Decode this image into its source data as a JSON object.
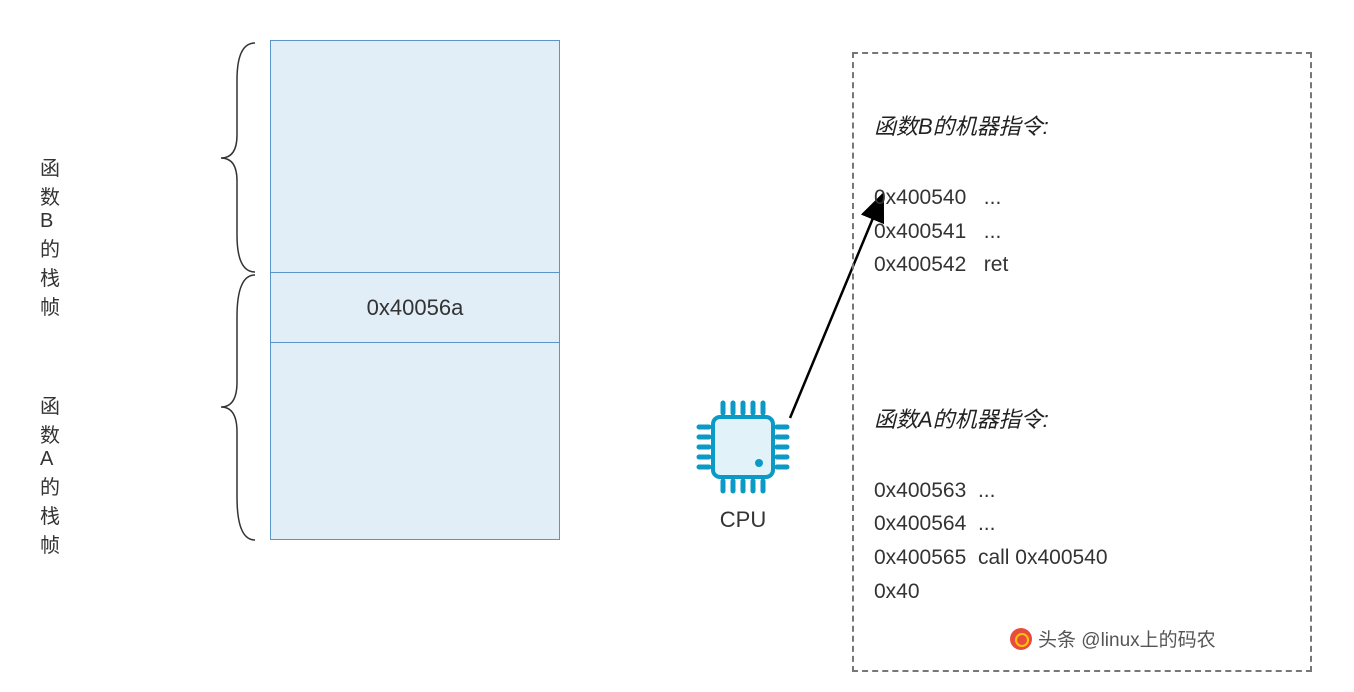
{
  "stack": {
    "label_b": "函数B的栈帧",
    "label_a": "函数A的栈帧",
    "return_address": "0x40056a"
  },
  "cpu": {
    "label": "CPU"
  },
  "instructions": {
    "section_b_title": "函数B的机器指令:",
    "section_a_title": "函数A的机器指令:",
    "b_lines": [
      {
        "addr": "0x400540",
        "instr": "..."
      },
      {
        "addr": "0x400541",
        "instr": "..."
      },
      {
        "addr": "0x400542",
        "instr": "ret"
      }
    ],
    "a_lines": [
      {
        "addr": "0x400563",
        "instr": "..."
      },
      {
        "addr": "0x400564",
        "instr": "..."
      },
      {
        "addr": "0x400565",
        "instr": "call 0x400540"
      },
      {
        "addr": "0x40",
        "instr": ""
      }
    ]
  },
  "watermark": {
    "text": "头条 @linux上的码农"
  }
}
